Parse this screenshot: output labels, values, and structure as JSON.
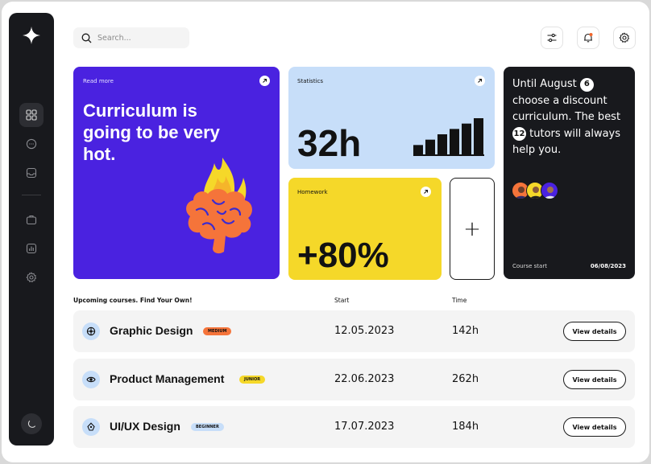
{
  "search": {
    "placeholder": "Search..."
  },
  "header": {
    "icons": [
      "sliders-icon",
      "bell-icon",
      "gear-icon"
    ],
    "bell_dot_color": "#f0652a"
  },
  "sidebar": {
    "items": [
      "grid-icon",
      "chat-icon",
      "inbox-icon",
      "briefcase-icon",
      "chart-icon",
      "settings-icon"
    ],
    "active": "grid-icon",
    "bottom": "moon-icon"
  },
  "cards": {
    "curriculum": {
      "label": "Read more",
      "title": "Curriculum is going to be very hot.",
      "bg": "#4a22e0"
    },
    "statistics": {
      "label": "Statistics",
      "value": "32h",
      "bars": [
        1,
        2,
        3,
        4,
        5,
        6
      ],
      "bg": "#c7def9"
    },
    "homework": {
      "label": "Homework",
      "value": "+80%",
      "bg": "#f5d829"
    },
    "add": {
      "symbol": "+"
    },
    "promo": {
      "text_1": "Until August",
      "num_1": "6",
      "text_2": "choose a discount curriculum. The best",
      "num_2": "12",
      "text_3": "tutors will always help you.",
      "course_start_label": "Course start",
      "course_start_date": "06/08/2023",
      "bg": "#18191d"
    }
  },
  "table": {
    "headers": {
      "title": "Upcoming courses. Find Your Own!",
      "start": "Start",
      "time": "Time"
    },
    "rows": [
      {
        "title": "Graphic Design",
        "level": "MEDIUM",
        "level_color": "#f5743a",
        "start": "12.05.2023",
        "time": "142h",
        "button": "View details",
        "icon": "aperture-icon"
      },
      {
        "title": "Product Management",
        "level": "JUNIOR",
        "level_color": "#f5d829",
        "start": "22.06.2023",
        "time": "262h",
        "button": "View details",
        "icon": "eye-icon"
      },
      {
        "title": "UI/UX Design",
        "level": "BEGINNER",
        "level_color": "#c7def9",
        "start": "17.07.2023",
        "time": "184h",
        "button": "View details",
        "icon": "pen-tool-icon"
      }
    ]
  }
}
